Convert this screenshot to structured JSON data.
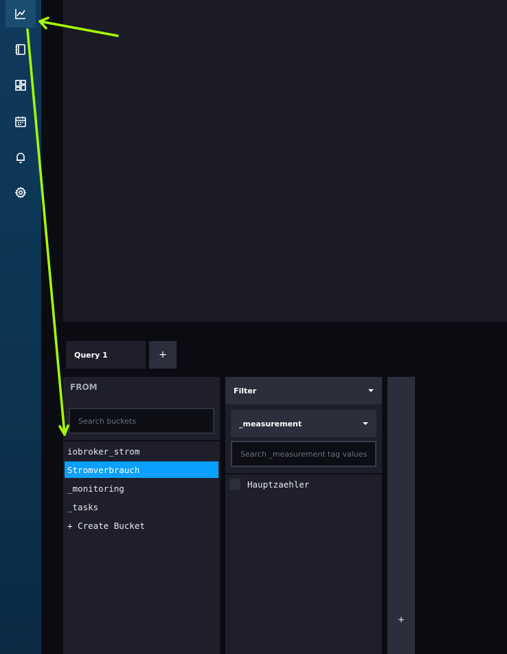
{
  "sidebar": {
    "items": [
      {
        "name": "data-explorer",
        "icon": "line-chart-icon",
        "active": true
      },
      {
        "name": "notebooks",
        "icon": "notebook-icon"
      },
      {
        "name": "dashboards",
        "icon": "dashboard-grid-icon"
      },
      {
        "name": "tasks",
        "icon": "calendar-icon"
      },
      {
        "name": "alerts",
        "icon": "bell-icon"
      },
      {
        "name": "settings",
        "icon": "gear-icon"
      }
    ]
  },
  "query": {
    "tab_label": "Query 1",
    "add_label": "+"
  },
  "from": {
    "title": "FROM",
    "search_placeholder": "Search buckets",
    "buckets": [
      {
        "label": "iobroker_strom",
        "selected": false
      },
      {
        "label": "Stromverbrauch",
        "selected": true
      },
      {
        "label": "_monitoring",
        "selected": false
      },
      {
        "label": "_tasks",
        "selected": false
      },
      {
        "label": "+ Create Bucket",
        "selected": false
      }
    ]
  },
  "filter": {
    "header_label": "Filter",
    "key_selected": "_measurement",
    "search_placeholder": "Search _measurement tag values",
    "values": [
      {
        "label": "Hauptzaehler",
        "checked": false
      }
    ]
  },
  "add_filter": {
    "label": "+"
  },
  "colors": {
    "accent": "#0aa0ff",
    "annotation": "#a6ff00",
    "panel": "#1e1f2a"
  }
}
